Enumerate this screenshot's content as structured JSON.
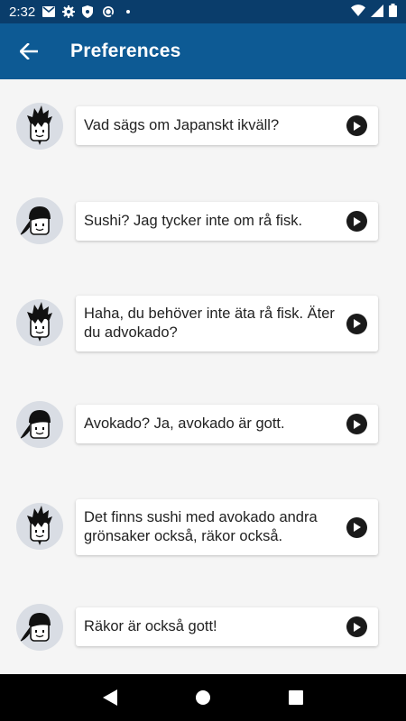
{
  "status_bar": {
    "time": "2:32",
    "icons_left": [
      "gmail-icon",
      "gear-icon",
      "shield-icon",
      "sync-icon",
      "dot-icon"
    ],
    "icons_right": [
      "wifi-icon",
      "signal-icon",
      "battery-icon"
    ]
  },
  "app_bar": {
    "title": "Preferences",
    "back_icon": "arrow-left-icon"
  },
  "messages": [
    {
      "speaker": "spiky-hair",
      "text": "Vad sägs om Japanskt ikväll?"
    },
    {
      "speaker": "ponytail",
      "text": "Sushi? Jag tycker inte om rå fisk."
    },
    {
      "speaker": "spiky-hair",
      "text": "Haha, du behöver inte äta rå fisk. Äter du advokado?"
    },
    {
      "speaker": "ponytail",
      "text": "Avokado? Ja, avokado är gott."
    },
    {
      "speaker": "spiky-hair",
      "text": "Det finns sushi med avokado andra grönsaker också, räkor också."
    },
    {
      "speaker": "ponytail",
      "text": "Räkor är också gott!"
    }
  ],
  "nav_bar": {
    "buttons": [
      "back-triangle-icon",
      "home-circle-icon",
      "recents-square-icon"
    ]
  },
  "colors": {
    "status_bar": "#0a3d6b",
    "app_bar": "#0d5a94",
    "background": "#f5f5f5",
    "avatar_bg": "#d9dde4"
  }
}
